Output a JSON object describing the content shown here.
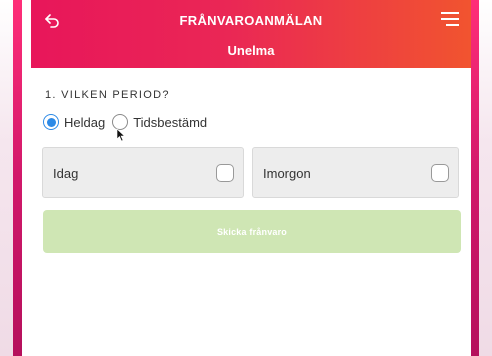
{
  "header": {
    "title": "FRÅNVAROANMÄLAN",
    "subtitle": "Unelma",
    "back_icon": "back-arrow-icon",
    "menu_icon": "hamburger-menu-icon"
  },
  "period": {
    "label": "1. VILKEN PERIOD?",
    "options": [
      {
        "label": "Heldag",
        "checked": true
      },
      {
        "label": "Tidsbestämd",
        "checked": false
      }
    ]
  },
  "days": {
    "today": {
      "label": "Idag",
      "checked": false
    },
    "tomorrow": {
      "label": "Imorgon",
      "checked": false
    }
  },
  "submit": {
    "label": "Skicka frånvaro",
    "enabled": false
  },
  "colors": {
    "header_start": "#e8165a",
    "header_end": "#f1542f",
    "radio_accent": "#2d8ae6",
    "submit_disabled": "#cfe6b4"
  }
}
